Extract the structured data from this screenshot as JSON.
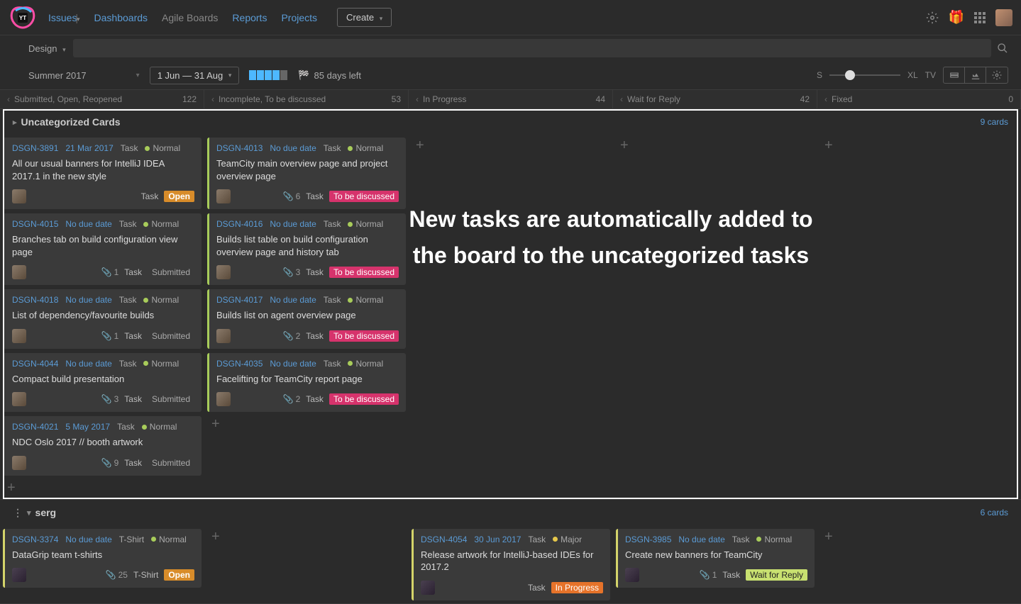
{
  "nav": {
    "issues": "Issues",
    "dashboards": "Dashboards",
    "agile": "Agile Boards",
    "reports": "Reports",
    "projects": "Projects",
    "create": "Create"
  },
  "filter": {
    "label": "Design"
  },
  "sprint": {
    "name": "Summer 2017",
    "daterange": "1 Jun — 31 Aug",
    "days_left": "85 days left",
    "size_s": "S",
    "size_xl": "XL",
    "tv": "TV"
  },
  "columns": [
    {
      "label": "Submitted, Open, Reopened",
      "count": "122"
    },
    {
      "label": "Incomplete, To be discussed",
      "count": "53"
    },
    {
      "label": "In Progress",
      "count": "44"
    },
    {
      "label": "Wait for Reply",
      "count": "42"
    },
    {
      "label": "Fixed",
      "count": "0"
    }
  ],
  "swimlanes": {
    "uncat": {
      "title": "Uncategorized Cards",
      "count": "9 cards"
    },
    "serg": {
      "title": "serg",
      "count": "6 cards"
    }
  },
  "overlay": "New tasks are automatically added to the board to the uncategorized tasks",
  "cards": {
    "c1": {
      "id": "DSGN-3891",
      "due": "21 Mar 2017",
      "type": "Task",
      "priority": "Normal",
      "title": "All our usual banners for IntelliJ IDEA 2017.1 in the new style",
      "footer_type": "Task",
      "state": "Open"
    },
    "c2": {
      "id": "DSGN-4015",
      "due": "No due date",
      "type": "Task",
      "priority": "Normal",
      "title": "Branches tab on build configuration view page",
      "att": "1",
      "footer_type": "Task",
      "state": "Submitted"
    },
    "c3": {
      "id": "DSGN-4018",
      "due": "No due date",
      "type": "Task",
      "priority": "Normal",
      "title": "List of dependency/favourite builds",
      "att": "1",
      "footer_type": "Task",
      "state": "Submitted"
    },
    "c4": {
      "id": "DSGN-4044",
      "due": "No due date",
      "type": "Task",
      "priority": "Normal",
      "title": "Compact build presentation",
      "att": "3",
      "footer_type": "Task",
      "state": "Submitted"
    },
    "c5": {
      "id": "DSGN-4021",
      "due": "5 May 2017",
      "type": "Task",
      "priority": "Normal",
      "title": "NDC Oslo 2017 // booth artwork",
      "att": "9",
      "footer_type": "Task",
      "state": "Submitted"
    },
    "c6": {
      "id": "DSGN-4013",
      "due": "No due date",
      "type": "Task",
      "priority": "Normal",
      "title": "TeamCity main overview page and project overview page",
      "att": "6",
      "footer_type": "Task",
      "state": "To be discussed"
    },
    "c7": {
      "id": "DSGN-4016",
      "due": "No due date",
      "type": "Task",
      "priority": "Normal",
      "title": "Builds list table on build configuration overview page and history tab",
      "att": "3",
      "footer_type": "Task",
      "state": "To be discussed"
    },
    "c8": {
      "id": "DSGN-4017",
      "due": "No due date",
      "type": "Task",
      "priority": "Normal",
      "title": "Builds list on agent overview page",
      "att": "2",
      "footer_type": "Task",
      "state": "To be discussed"
    },
    "c9": {
      "id": "DSGN-4035",
      "due": "No due date",
      "type": "Task",
      "priority": "Normal",
      "title": "Facelifting for TeamCity report page",
      "att": "2",
      "footer_type": "Task",
      "state": "To be discussed"
    },
    "s1": {
      "id": "DSGN-3374",
      "due": "No due date",
      "type": "T-Shirt",
      "priority": "Normal",
      "title": "DataGrip team t-shirts",
      "att": "25",
      "footer_type": "T-Shirt",
      "state": "Open"
    },
    "s2": {
      "id": "DSGN-4054",
      "due": "30 Jun 2017",
      "type": "Task",
      "priority": "Major",
      "title": "Release artwork for IntelliJ-based IDEs for 2017.2",
      "footer_type": "Task",
      "state": "In Progress"
    },
    "s3": {
      "id": "DSGN-3985",
      "due": "No due date",
      "type": "Task",
      "priority": "Normal",
      "title": "Create new banners for TeamCity",
      "att": "1",
      "footer_type": "Task",
      "state": "Wait for Reply"
    }
  }
}
